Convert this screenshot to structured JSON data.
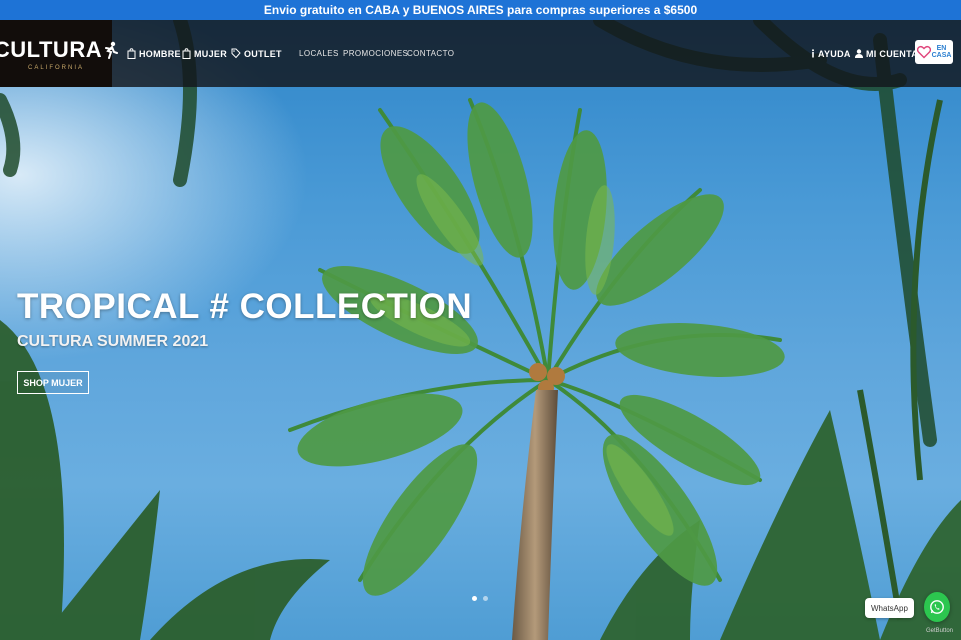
{
  "promo": {
    "text": "Envio gratuito en CABA y BUENOS AIRES para compras superiores a $6500"
  },
  "brand": {
    "name": "CULTURA",
    "tagline": "CALIFORNIA"
  },
  "nav": {
    "hombre": "HOMBRE",
    "mujer": "MUJER",
    "outlet": "OUTLET",
    "locales": "LOCALES",
    "promociones": "PROMOCIONES",
    "contacto": "CONTACTO",
    "ayuda": "AYUDA",
    "mi_cuenta": "MI CUENTA",
    "en_casa_line1": "EN",
    "en_casa_line2": "CASA"
  },
  "hero": {
    "title": "TROPICAL # COLLECTION",
    "subtitle": "CULTURA SUMMER 2021",
    "cta": "SHOP MUJER",
    "slides": 2,
    "active_slide": 1
  },
  "whatsapp": {
    "label": "WhatsApp",
    "credit": "GetButton"
  },
  "colors": {
    "promo_bg": "#1e73d6",
    "whatsapp": "#2cc64f",
    "brand_gold": "#c9a96a"
  }
}
